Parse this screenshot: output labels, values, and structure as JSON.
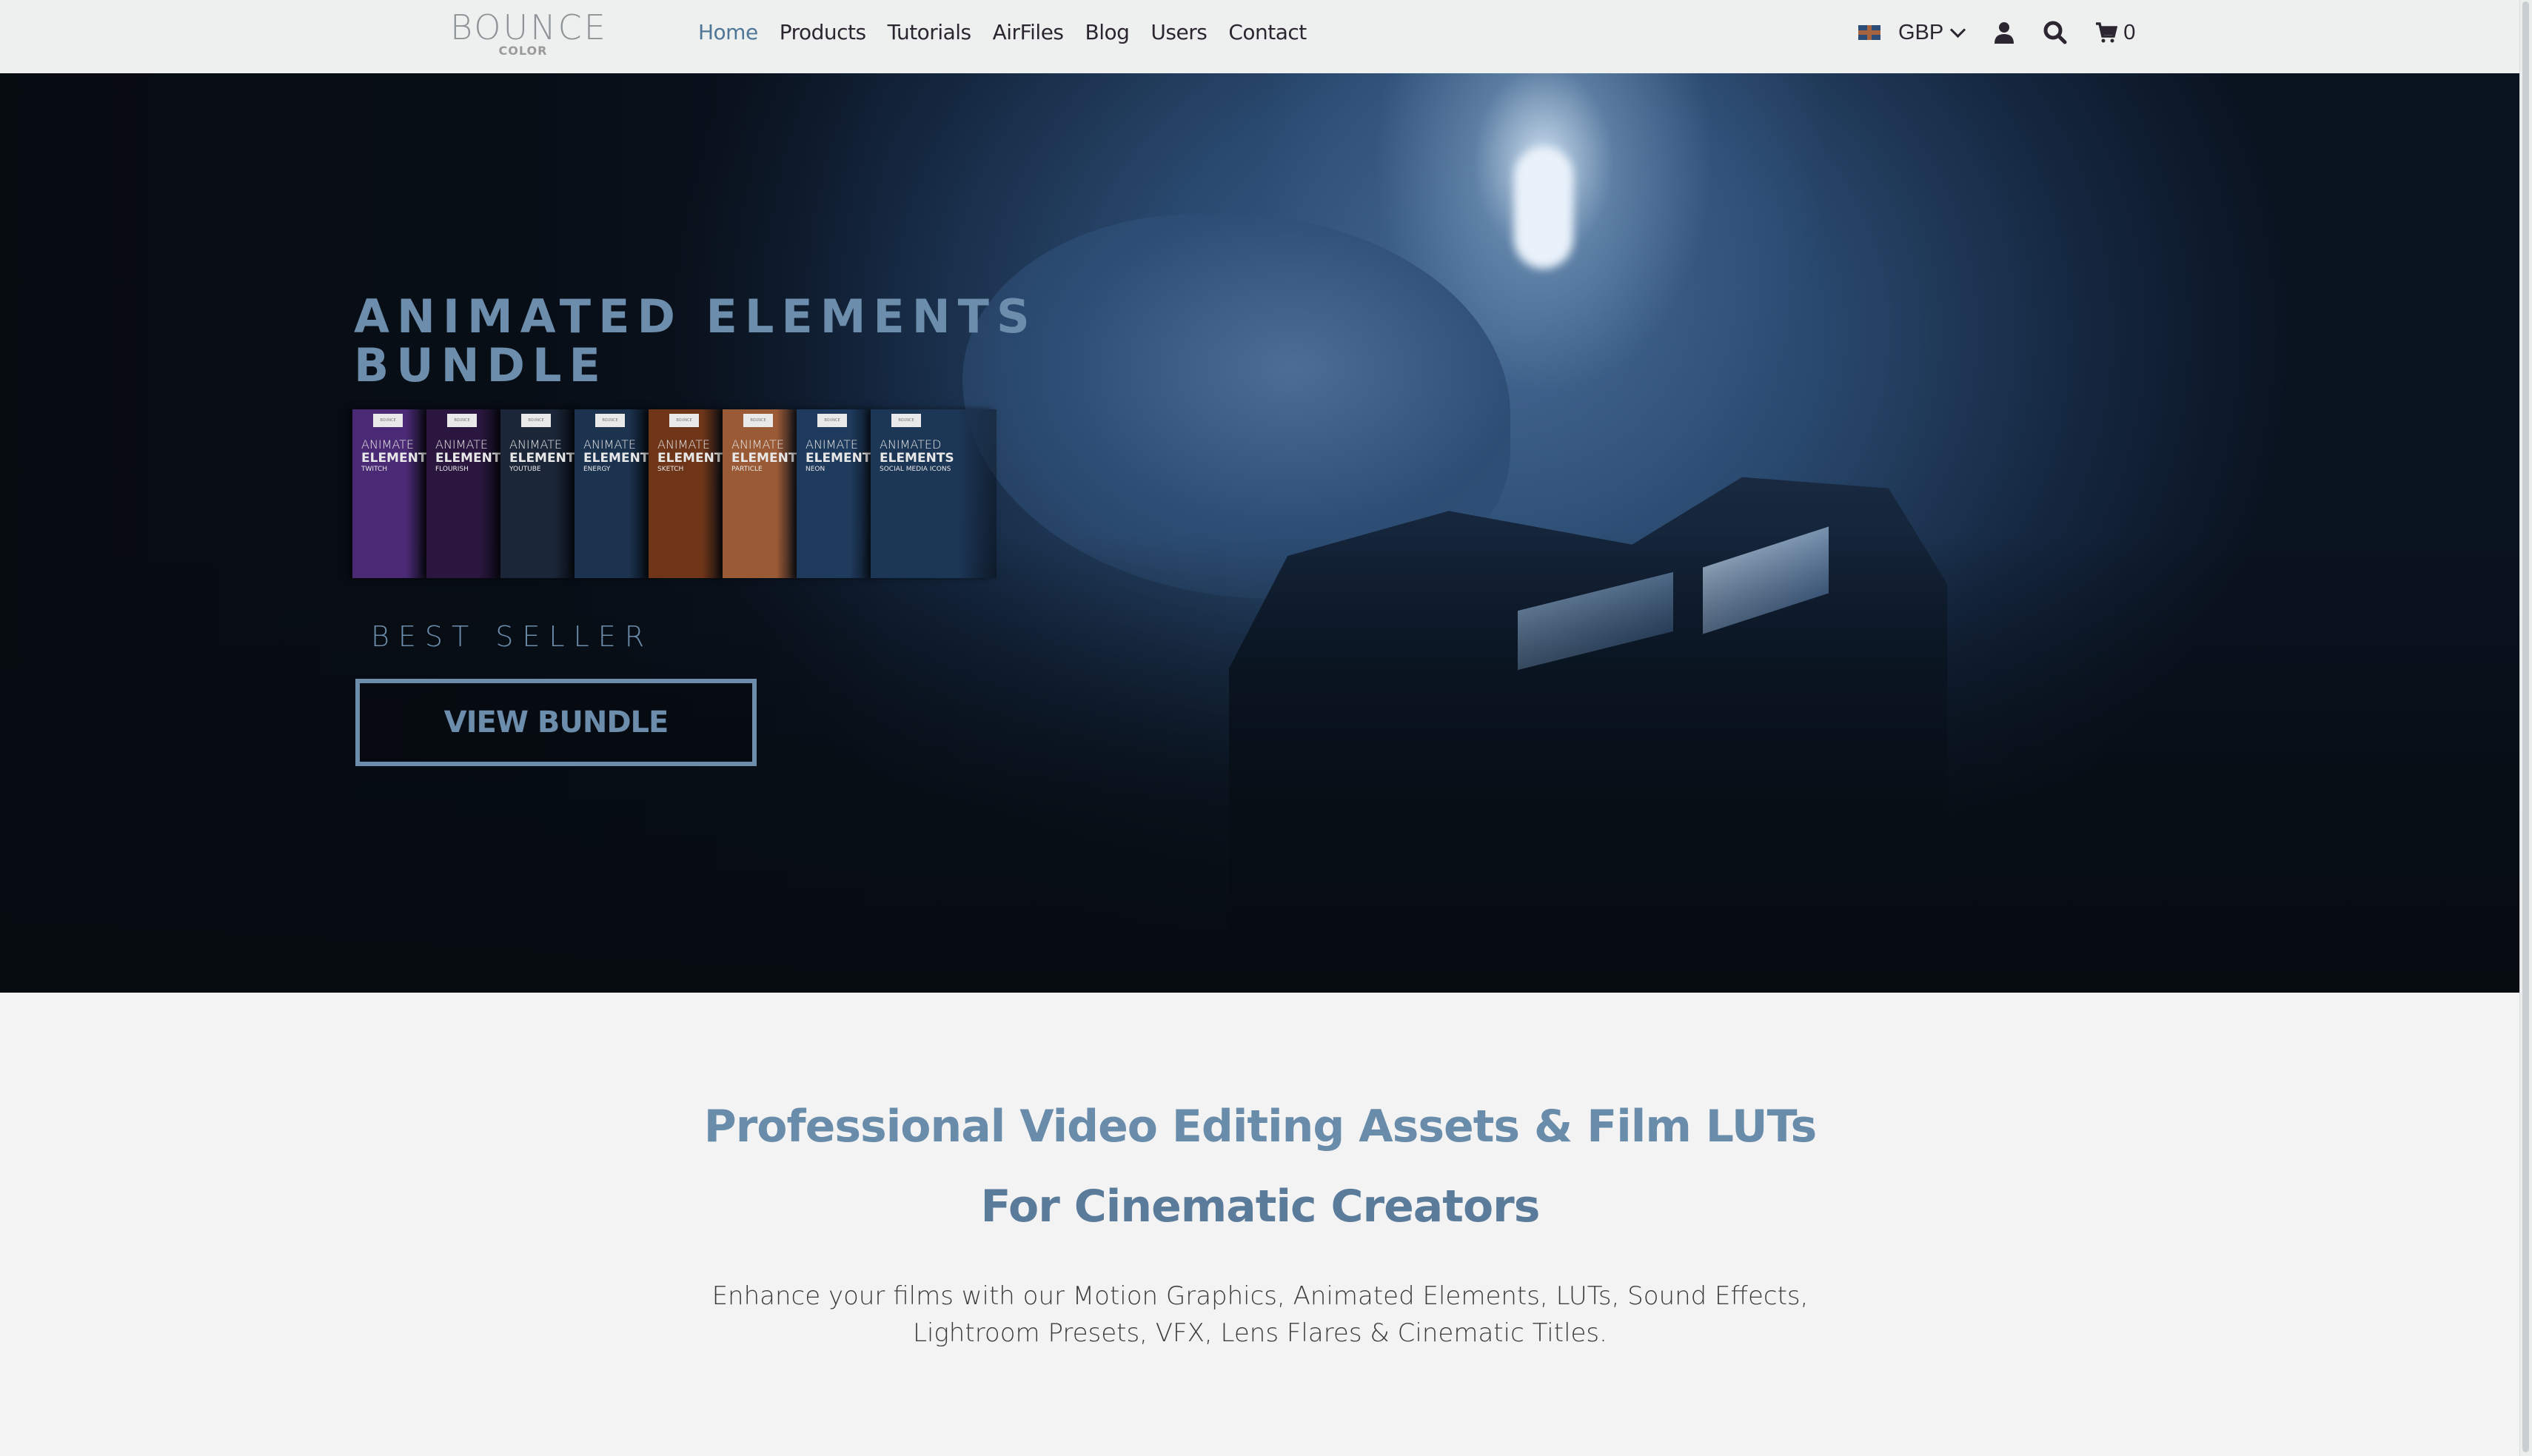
{
  "nav": {
    "logo": {
      "main": "BOUNCE",
      "sub": "COLOR"
    },
    "menu": [
      {
        "label": "Home",
        "active": true
      },
      {
        "label": "Products",
        "active": false
      },
      {
        "label": "Tutorials",
        "active": false
      },
      {
        "label": "AirFiles",
        "active": false
      },
      {
        "label": "Blog",
        "active": false
      },
      {
        "label": "Users",
        "active": false
      },
      {
        "label": "Contact",
        "active": false
      }
    ],
    "currency": "GBP",
    "flag_icon": "uk-flag-icon",
    "account_icon": "user-icon",
    "search_icon": "search-icon",
    "cart_icon": "cart-icon",
    "cart_count": "0"
  },
  "hero": {
    "title_line1": "ANIMATED ELEMENTS",
    "title_line2": "BUNDLE",
    "products": [
      {
        "line1": "ANIMATE",
        "line2": "ELEMENT",
        "line3": "TWITCH",
        "color": "#4a2a74"
      },
      {
        "line1": "ANIMATE",
        "line2": "ELEMENT",
        "line3": "FLOURISH",
        "color": "#2a163e"
      },
      {
        "line1": "ANIMATE",
        "line2": "ELEMENT",
        "line3": "YOUTUBE",
        "color": "#1b2638"
      },
      {
        "line1": "ANIMATE",
        "line2": "ELEMENT",
        "line3": "ENERGY",
        "color": "#1c3350"
      },
      {
        "line1": "ANIMATE",
        "line2": "ELEMENT",
        "line3": "SKETCH",
        "color": "#6e3518"
      },
      {
        "line1": "ANIMATE",
        "line2": "ELEMENT",
        "line3": "PARTICLE",
        "color": "#9a5a36"
      },
      {
        "line1": "ANIMATE",
        "line2": "ELEMENT",
        "line3": "NEON",
        "color": "#1e3a5c"
      },
      {
        "line1": "ANIMATED",
        "line2": "ELEMENTS",
        "line3": "SOCIAL MEDIA ICONS",
        "color": "#1c3655"
      }
    ],
    "badge": "BEST SELLER",
    "cta_label": "VIEW BUNDLE"
  },
  "intro": {
    "heading_line1": "Professional Video Editing Assets & Film LUTs",
    "heading_line2": "For Cinematic Creators",
    "description_line1": "Enhance your films with our Motion Graphics, Animated Elements, LUTs, Sound Effects,",
    "description_line2": "Lightroom Presets, VFX, Lens Flares & Cinematic Titles."
  },
  "colors": {
    "accent": "#6c8dac",
    "nav_active": "#4f7697",
    "text_dark": "#2b2630"
  }
}
